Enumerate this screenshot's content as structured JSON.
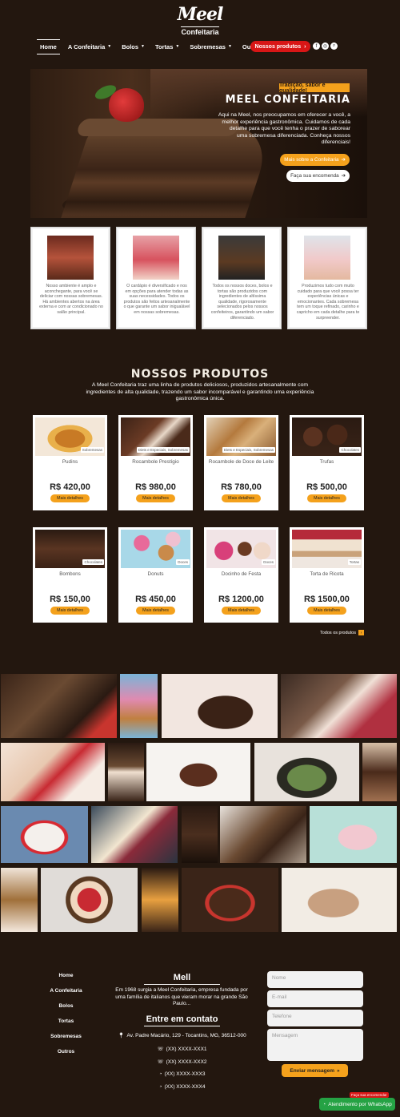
{
  "brand": {
    "name": "Meel",
    "sub": "Confeitaria"
  },
  "nav": [
    {
      "label": "Home"
    },
    {
      "label": "A Confeitaria"
    },
    {
      "label": "Bolos"
    },
    {
      "label": "Tortas"
    },
    {
      "label": "Sobremesas"
    },
    {
      "label": "Outros"
    }
  ],
  "header": {
    "cta_label": "Nossos produtos"
  },
  "hero": {
    "tag": "Tradição, sabor e qualidade!",
    "title": "MEEL CONFEITARIA",
    "text": "Aqui na Meel, nos preocupamos em oferecer a você, a melhor experiência gastronômica. Cuidamos de cada detalhe para que você tenha o prazer de saborear uma sobremesa diferenciada. Conheça nossos diferenciais!",
    "btn_primary": "Mais sobre a Confeitaria",
    "btn_secondary": "Faça sua encomenda"
  },
  "features": [
    {
      "text": "Nosso ambiente é amplo e aconchegante, para você se deliciar com nossas sobremesas. Há ambientes abertos na área externa e com ar condicionado no salão principal."
    },
    {
      "text": "O cardápio é diversificado e nos em opções para atender todas as suas necessidades. Todos os produtos são feitos artesanalmente o que garante um sabor inigualável em nossas sobremesas."
    },
    {
      "text": "Todos os nossos doces, bolos e tortas são produzidos com ingredientes de altíssima qualidade, rigorosamente selecionados pelos nossos confeiteiros, garantindo um sabor diferenciado."
    },
    {
      "text": "Produzimos tudo com muito cuidado para que você possa ter experiências únicas e emocionantes. Cada sobremesa tem um toque refinado, carinho e capricho em cada detalhe para te surpreender."
    }
  ],
  "products_section": {
    "title": "NOSSOS PRODUTOS",
    "subtitle": "A Meel Confeitaria traz uma linha de produtos deliciosos, produzidos artesanalmente com ingredientes de alta qualidade, trazendo um sabor incomparável e garantindo uma experiência gastronômica única.",
    "more_label": "Mais detalhes",
    "all_label": "Todos os produtos"
  },
  "products": [
    {
      "name": "Pudins",
      "price": "R$ 420,00",
      "badge": "Sobremesas"
    },
    {
      "name": "Rocambole Prestígio",
      "price": "R$ 980,00",
      "badge": "Diets e Especiais, Sobremesas"
    },
    {
      "name": "Rocambole de Doce de Leite",
      "price": "R$ 780,00",
      "badge": "Diets e Especiais, Sobremesas"
    },
    {
      "name": "Trufas",
      "price": "R$ 500,00",
      "badge": "Chocolates"
    },
    {
      "name": "Bombons",
      "price": "R$ 150,00",
      "badge": "Chocolates"
    },
    {
      "name": "Donuts",
      "price": "R$ 450,00",
      "badge": "Doces"
    },
    {
      "name": "Docinho de Festa",
      "price": "R$ 1200,00",
      "badge": "Doces"
    },
    {
      "name": "Torta de Ricota",
      "price": "R$ 1500,00",
      "badge": "Tortas"
    }
  ],
  "footer": {
    "nav": [
      {
        "label": "Home"
      },
      {
        "label": "A Confeitaria"
      },
      {
        "label": "Bolos"
      },
      {
        "label": "Tortas"
      },
      {
        "label": "Sobremesas"
      },
      {
        "label": "Outros"
      }
    ],
    "about_title": "Mell",
    "about_text": "Em 1968 surgia a Meel Confeitaria, empresa fundada por uma família de italianos que vieram morar na grande São Paulo...",
    "contact_title": "Entre em contato",
    "address": "Av. Padre Macário, 129 - Tocantins, MG, 36512-000",
    "phones": [
      "(XX) XXXX-XXX1",
      "(XX) XXXX-XXX2",
      "(XX) XXXX-XXX3",
      "(XX) XXXX-XXX4"
    ],
    "form": {
      "name": "Nome",
      "email": "E-mail",
      "phone": "Telefone",
      "message": "Mensagem",
      "send": "Enviar mensagem"
    }
  },
  "whatsapp": {
    "label": "Atendimento por WhatsApp",
    "tooltip": "Faça sua encomenda!"
  },
  "colors": {
    "accent": "#f4a11c",
    "cta_red": "#d81616",
    "background": "#23170f",
    "whatsapp": "#25a244"
  }
}
